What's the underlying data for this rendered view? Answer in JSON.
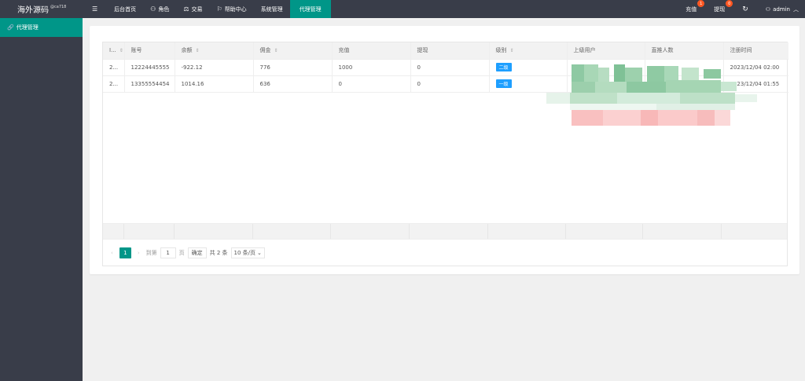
{
  "header": {
    "logo": "海外源码",
    "logo_sup": "@ca718",
    "nav": [
      {
        "icon": "menu-icon",
        "glyph": "☰",
        "label": ""
      },
      {
        "icon": "",
        "glyph": "",
        "label": "后台首页"
      },
      {
        "icon": "user-icon",
        "glyph": "⚇",
        "label": "角色"
      },
      {
        "icon": "scale-icon",
        "glyph": "⚖",
        "label": "交易"
      },
      {
        "icon": "flag-icon",
        "glyph": "⚐",
        "label": "帮助中心"
      },
      {
        "icon": "",
        "glyph": "",
        "label": "系统管理"
      },
      {
        "icon": "",
        "glyph": "",
        "label": "代理管理"
      }
    ],
    "recharge_label": "充值",
    "recharge_badge": "1",
    "withdraw_label": "提现",
    "withdraw_badge": "0",
    "refresh_glyph": "↻",
    "user_label": "admin"
  },
  "sidebar": {
    "item_label": "代理管理"
  },
  "table": {
    "columns": [
      "I...",
      "账号",
      "余额",
      "佣金",
      "充值",
      "提现",
      "级别",
      "上级用户",
      "直推人数",
      "注册时间"
    ],
    "rows": [
      {
        "id": "2...",
        "account": "12224445555",
        "balance": "-922.12",
        "commission": "776",
        "recharge": "1000",
        "withdraw": "0",
        "level": "二级",
        "parent": "",
        "direct": "",
        "reg_time": "2023/12/04 02:00"
      },
      {
        "id": "2...",
        "account": "13355554454",
        "balance": "1014.16",
        "commission": "636",
        "recharge": "0",
        "withdraw": "0",
        "level": "一级",
        "parent": "",
        "direct": "",
        "reg_time": "2023/12/04 01:55"
      }
    ]
  },
  "pager": {
    "current": "1",
    "goto_label": "到第",
    "goto_value": "1",
    "page_unit": "页",
    "confirm_label": "确定",
    "total_label": "共 2 条",
    "size_label": "10 条/页"
  },
  "colors": {
    "header_bg": "#393d49",
    "accent": "#009688",
    "tag_blue": "#1e9fff",
    "badge": "#ff5722"
  }
}
